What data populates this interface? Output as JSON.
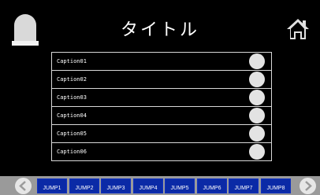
{
  "header": {
    "title": "タイトル"
  },
  "list": {
    "rows": [
      {
        "caption": "Caption01"
      },
      {
        "caption": "Caption02"
      },
      {
        "caption": "Caption03"
      },
      {
        "caption": "Caption04"
      },
      {
        "caption": "Caption05"
      },
      {
        "caption": "Caption06"
      }
    ]
  },
  "footer": {
    "jumps": [
      "JUMP1",
      "JUMP2",
      "JUMP3",
      "JUMP4",
      "JUMP5",
      "JUMP6",
      "JUMP7",
      "JUMP8"
    ]
  },
  "icons": {
    "lamp": "lamp-icon",
    "home": "home-icon",
    "prev": "chevron-left-icon",
    "next": "chevron-right-icon"
  },
  "colors": {
    "background": "#000000",
    "jump_button": "#0b2aa6",
    "footer_bar": "#9a9a9a",
    "indicator": "#e3e3e3"
  }
}
